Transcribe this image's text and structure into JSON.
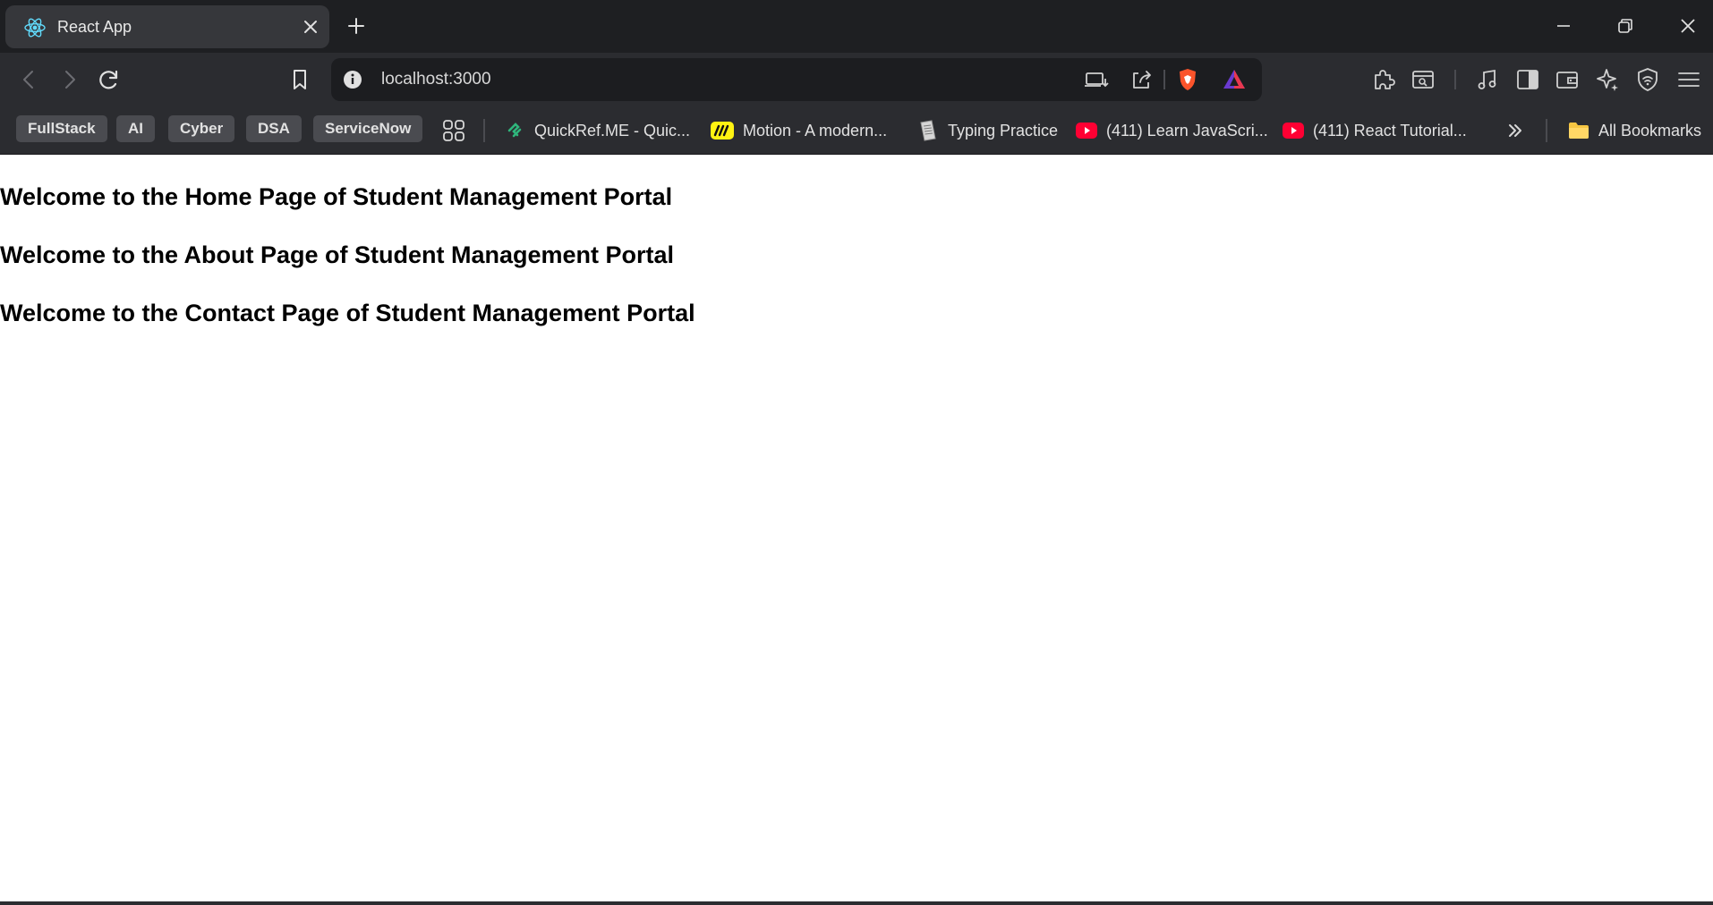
{
  "tab": {
    "title": "React App"
  },
  "address_bar": {
    "url": "localhost:3000"
  },
  "bookmarks": {
    "chips": [
      "FullStack",
      "AI",
      "Cyber",
      "DSA",
      "ServiceNow"
    ],
    "links": [
      "QuickRef.ME - Quic...",
      "Motion - A modern...",
      "Typing Practice",
      "(411) Learn JavaScri...",
      "(411) React Tutorial..."
    ],
    "all_bookmarks": "All Bookmarks"
  },
  "page": {
    "headings": [
      "Welcome to the Home Page of Student Management Portal",
      "Welcome to the About Page of Student Management Portal",
      "Welcome to the Contact Page of Student Management Portal"
    ]
  },
  "colors": {
    "tabstrip": "#1e1f22",
    "toolbar": "#2b2c30",
    "brave_orange": "#fb542b",
    "youtube_red": "#ff0033"
  }
}
